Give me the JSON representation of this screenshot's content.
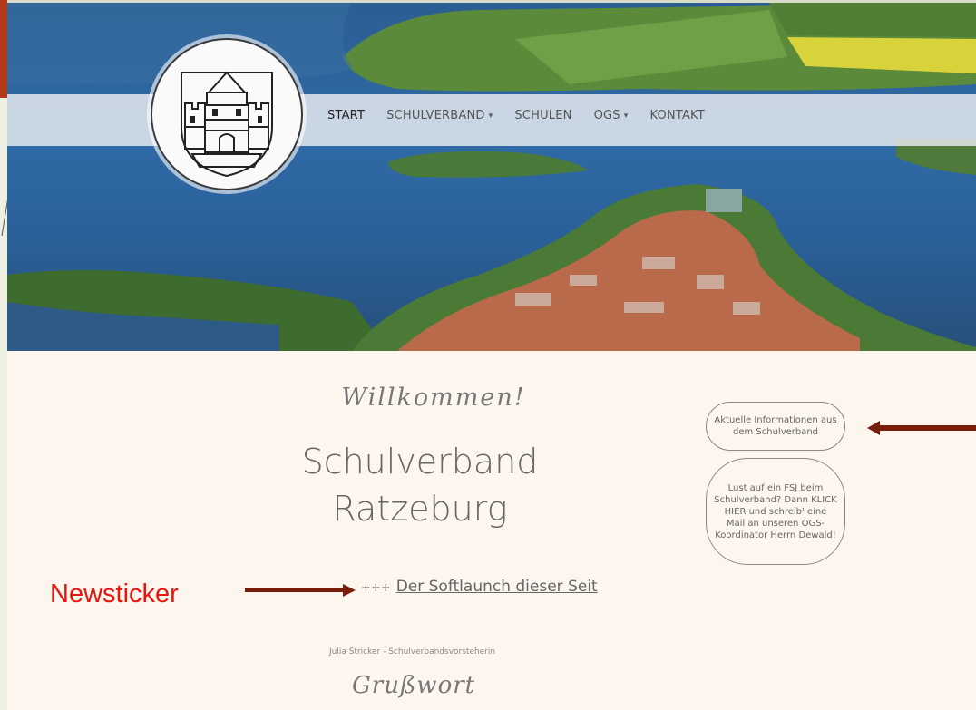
{
  "nav": {
    "items": [
      {
        "label": "START",
        "active": true,
        "dropdown": false
      },
      {
        "label": "SCHULVERBAND",
        "active": false,
        "dropdown": true
      },
      {
        "label": "SCHULEN",
        "active": false,
        "dropdown": false
      },
      {
        "label": "OGS",
        "active": false,
        "dropdown": true
      },
      {
        "label": "KONTAKT",
        "active": false,
        "dropdown": false
      }
    ],
    "caret": "▾"
  },
  "hero": {
    "image": "aerial-view-of-ratzeburg-island-town-and-lake"
  },
  "logo": {
    "icon": "ratzeburg-coat-of-arms-castle-icon"
  },
  "main": {
    "welcome": "Willkommen!",
    "title_line1": "Schulverband",
    "title_line2": "Ratzeburg",
    "ticker_prefix": "+++",
    "ticker_link": "Der Softlaunch dieser Seit",
    "byline": "Julia Stricker - Schulverbandsvorsteherin",
    "grusswort": "Grußwort"
  },
  "sidebar": {
    "info_button": "Aktuelle Informationen aus dem Schulverband",
    "fsj_button": "Lust auf ein FSJ beim Schulverband? Dann KLICK HIER und schreib' eine Mail an unseren OGS-Koordinator Herrn Dewald!"
  },
  "annotations": {
    "newsticker_label": "Newsticker",
    "arrow_color": "#7a1e0c",
    "label_color": "#e8140e"
  },
  "colors": {
    "content_bg": "#fdf6ee",
    "frame_red": "#b23a1a"
  }
}
